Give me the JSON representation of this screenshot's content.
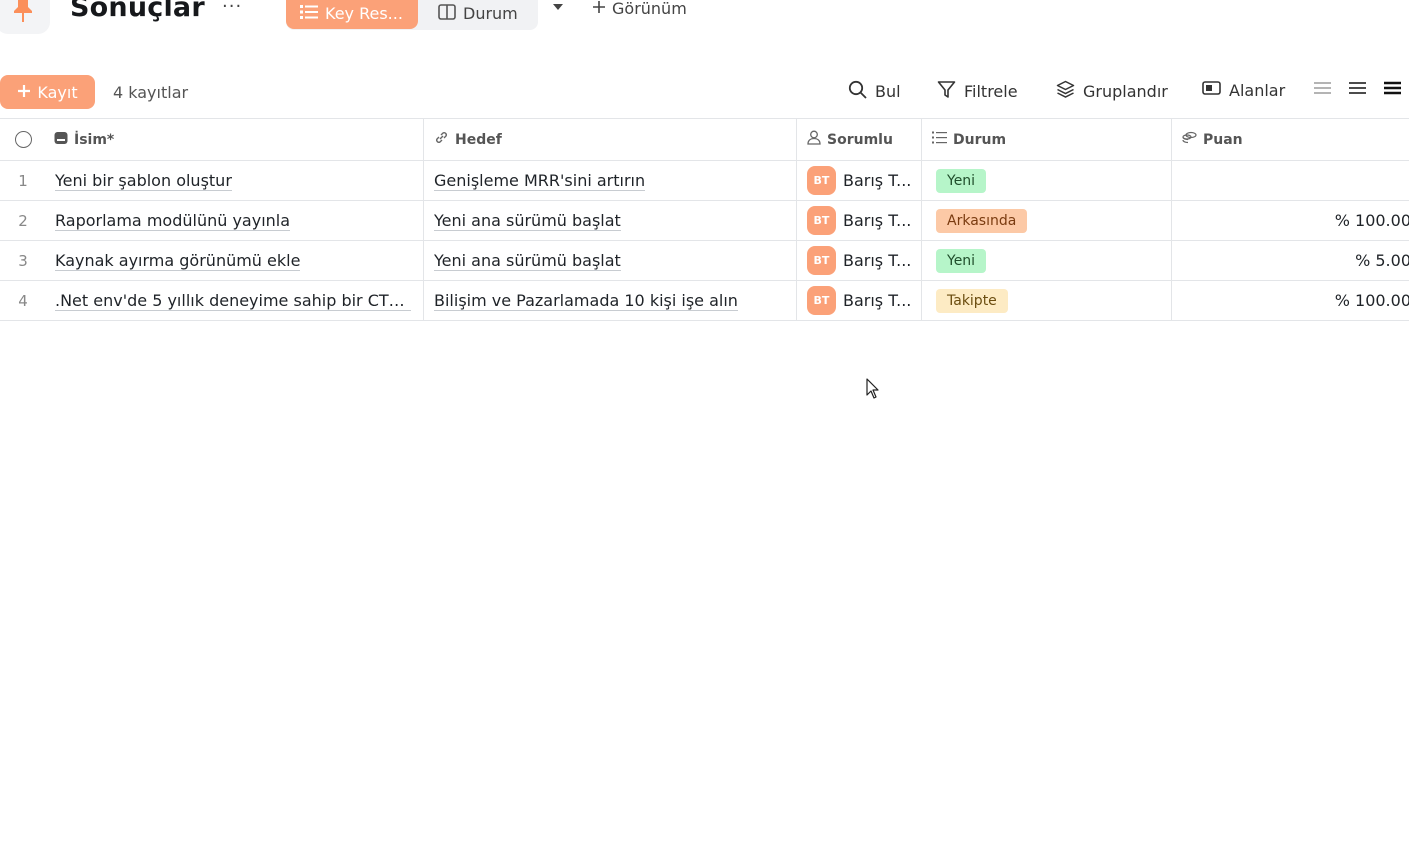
{
  "header": {
    "title": "Sonuçlar",
    "more": "···",
    "tabs": [
      {
        "label": "Key Res...",
        "active": true
      },
      {
        "label": "Durum",
        "active": false
      }
    ],
    "add_view": "Görünüm"
  },
  "toolbar": {
    "add_record": "Kayıt",
    "record_count": "4 kayıtlar",
    "find": "Bul",
    "filter": "Filtrele",
    "group": "Gruplandır",
    "fields": "Alanlar"
  },
  "columns": {
    "name": "İsim*",
    "goal": "Hedef",
    "owner": "Sorumlu",
    "status": "Durum",
    "score": "Puan"
  },
  "rows": [
    {
      "num": "1",
      "name": "Yeni bir şablon oluştur",
      "goal": "Genişleme MRR'sini artırın",
      "owner_initials": "BT",
      "owner": "Barış T...",
      "status": "Yeni",
      "score": ""
    },
    {
      "num": "2",
      "name": "Raporlama modülünü yayınla",
      "goal": "Yeni ana sürümü başlat",
      "owner_initials": "BT",
      "owner": "Barış T...",
      "status": "Arkasında",
      "score": "% 100.00"
    },
    {
      "num": "3",
      "name": "Kaynak ayırma görünümü ekle",
      "goal": "Yeni ana sürümü başlat",
      "owner_initials": "BT",
      "owner": "Barış T...",
      "status": "Yeni",
      "score": "% 5.00"
    },
    {
      "num": "4",
      "name": ".Net env'de 5 yıllık deneyime sahip bir CTO ...",
      "goal": "Bilişim ve Pazarlamada 10 kişi işe alın",
      "owner_initials": "BT",
      "owner": "Barış T...",
      "status": "Takipte",
      "score": "% 100.00"
    }
  ],
  "status_colors": {
    "Yeni": {
      "bg": "#b6f5c9",
      "fg": "#1f4d2b"
    },
    "Arkasında": {
      "bg": "#fcc9a6",
      "fg": "#7a3b10"
    },
    "Takipte": {
      "bg": "#fdebc4",
      "fg": "#6b4d10"
    }
  },
  "colors": {
    "accent": "#fba178"
  },
  "icons": [
    "pin-icon",
    "list-icon",
    "board-icon",
    "chevron-down-icon",
    "plus-icon",
    "search-icon",
    "filter-icon",
    "layers-icon",
    "fields-icon",
    "row-height-icons",
    "text-field-icon",
    "link-icon",
    "user-icon",
    "status-list-icon",
    "currency-icon"
  ]
}
